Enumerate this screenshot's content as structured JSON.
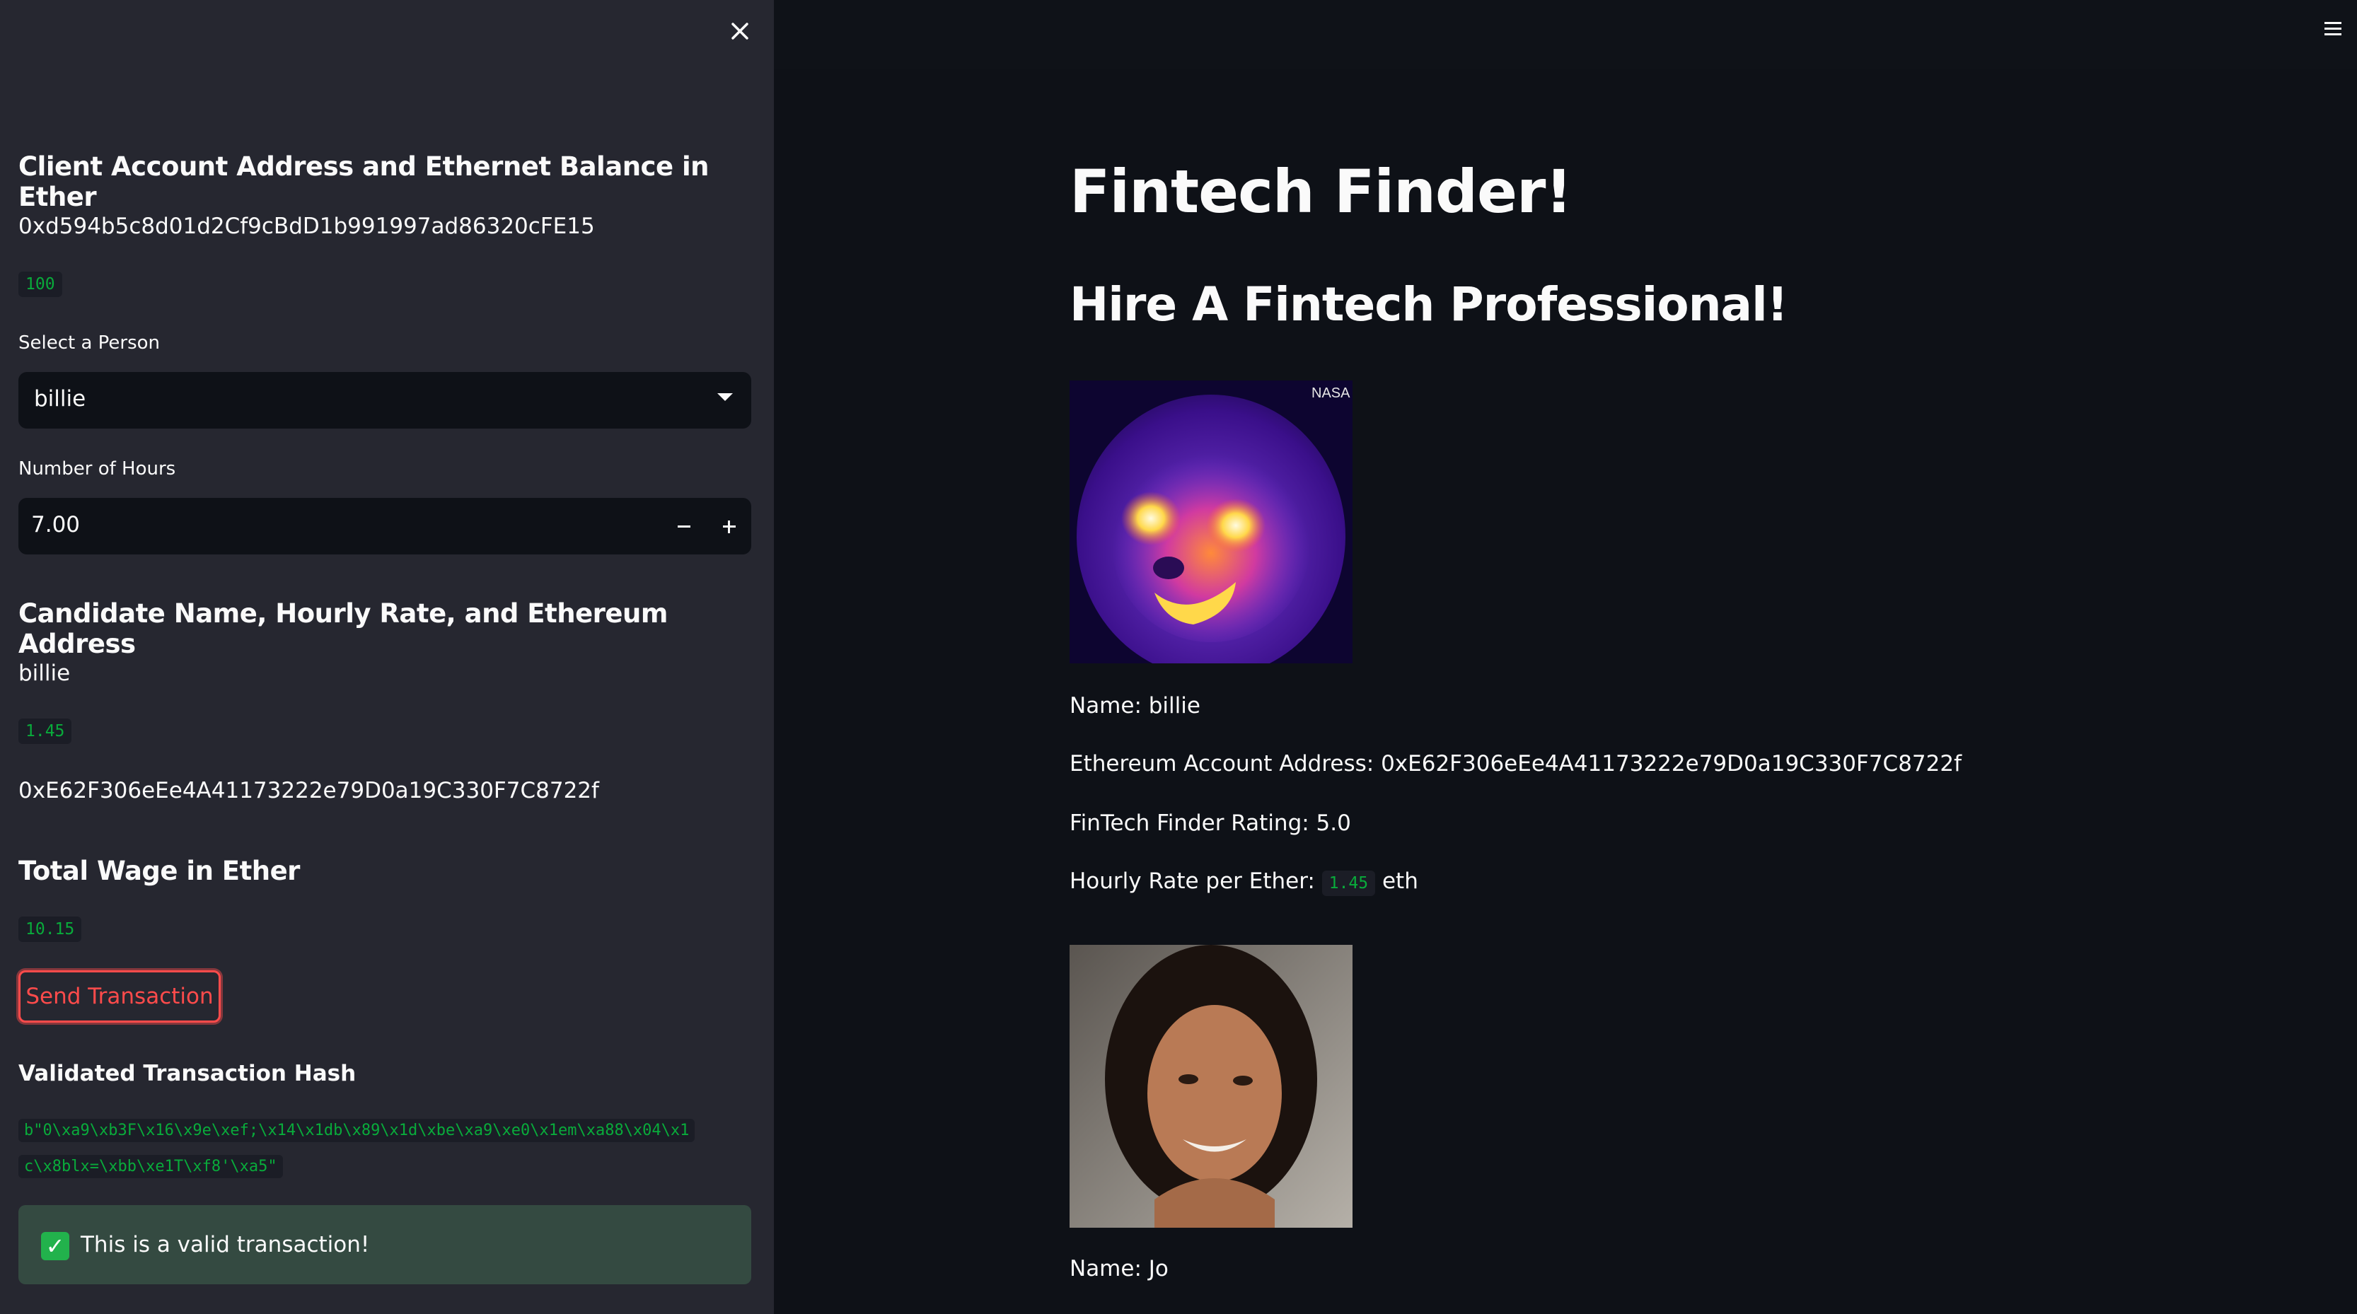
{
  "sidebar": {
    "account_heading": "Client Account Address and Ethernet Balance in Ether",
    "account_address": "0xd594b5c8d01d2Cf9cBdD1b991997ad86320cFE15",
    "balance": "100",
    "select_label": "Select a Person",
    "selected_person": "billie",
    "hours_label": "Number of Hours",
    "hours_value": "7.00",
    "candidate_heading": "Candidate Name, Hourly Rate, and Ethereum Address",
    "candidate_name": "billie",
    "candidate_rate": "1.45",
    "candidate_address": "0xE62F306eEe4A41173222e79D0a19C330F7C8722f",
    "wage_heading": "Total Wage in Ether",
    "wage_value": "10.15",
    "send_button": "Send Transaction",
    "hash_heading": "Validated Transaction Hash",
    "hash_line1": "b\"0\\xa9\\xb3F\\x16\\x9e\\xef;\\x14\\x1db\\x89\\x1d\\xbe\\xa9\\xe0\\x1em\\xa88\\x04\\x1",
    "hash_line2": "c\\x8blx=\\xbb\\xe1T\\xf8'\\xa5\"",
    "success_message": "This is a valid transaction!"
  },
  "main": {
    "title": "Fintech Finder!",
    "subtitle": "Hire A Fintech Professional!",
    "candidate1": {
      "image_watermark": "NASA",
      "name_line": "Name: billie",
      "address_line": "Ethereum Account Address: 0xE62F306eEe4A41173222e79D0a19C330F7C8722f",
      "rating_line": "FinTech Finder Rating: 5.0",
      "rate_prefix": "Hourly Rate per Ether:",
      "rate_value": "1.45",
      "rate_suffix": "eth"
    },
    "candidate2": {
      "name_line": "Name: Jo"
    }
  },
  "icons": {
    "close": "close-icon",
    "menu": "hamburger-menu-icon",
    "dropdown": "chevron-down-icon",
    "check": "check-icon"
  },
  "colors": {
    "sidebar_bg": "#262730",
    "main_bg": "#0e1117",
    "accent": "#ff4b4b",
    "code_green": "#09ab3b",
    "success_bg": "#344a41"
  }
}
